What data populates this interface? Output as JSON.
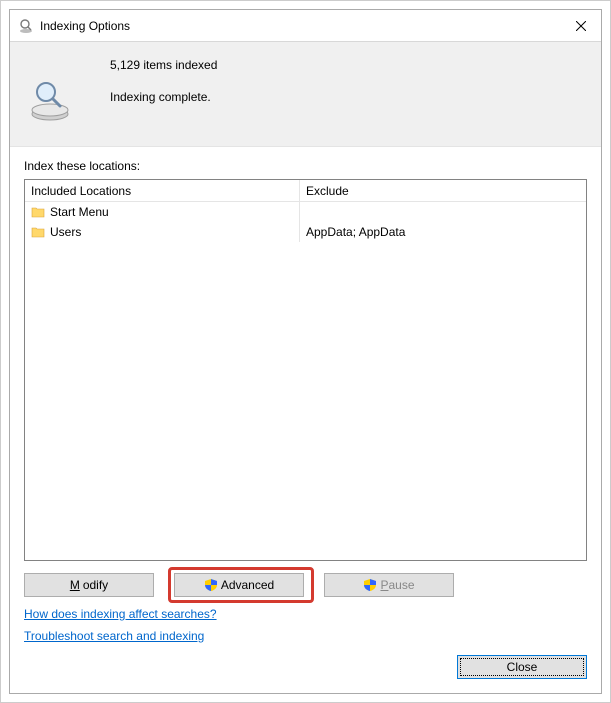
{
  "title": "Indexing Options",
  "status": {
    "count_line": "5,129 items indexed",
    "state_line": "Indexing complete."
  },
  "section_label": "Index these locations:",
  "table": {
    "headers": {
      "included": "Included Locations",
      "exclude": "Exclude"
    },
    "rows": [
      {
        "name": "Start Menu",
        "exclude": ""
      },
      {
        "name": "Users",
        "exclude": "AppData; AppData"
      }
    ]
  },
  "buttons": {
    "modify": "Modify",
    "advanced": "Advanced",
    "pause": "Pause",
    "close": "Close"
  },
  "links": {
    "how_affect": "How does indexing affect searches?",
    "troubleshoot": "Troubleshoot search and indexing"
  }
}
